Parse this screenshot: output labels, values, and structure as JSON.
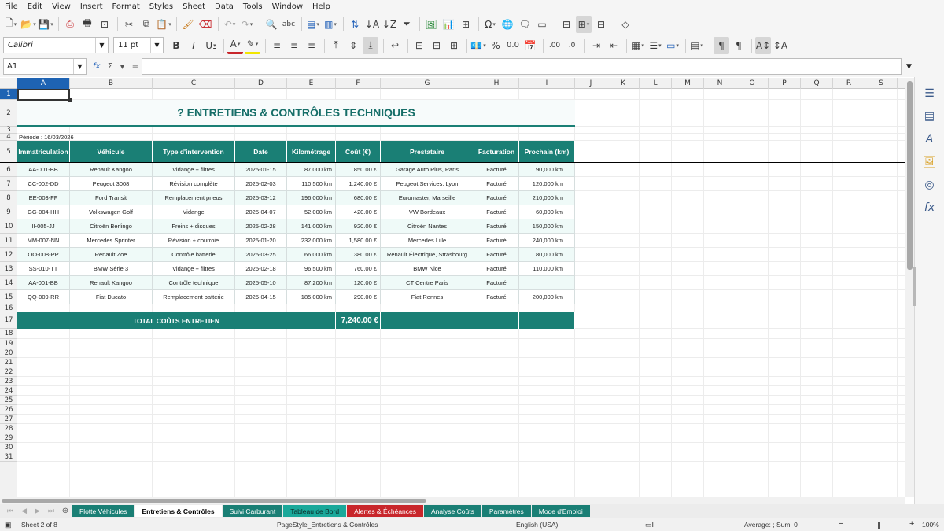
{
  "menu": [
    "File",
    "Edit",
    "View",
    "Insert",
    "Format",
    "Styles",
    "Sheet",
    "Data",
    "Tools",
    "Window",
    "Help"
  ],
  "toolbar": {
    "font_name": "Calibri",
    "font_size": "11 pt"
  },
  "formula_bar": {
    "cell_ref": "A1",
    "fx": "fx",
    "sigma": "Σ",
    "equals": "=",
    "content": ""
  },
  "columns": [
    "A",
    "B",
    "C",
    "D",
    "E",
    "F",
    "G",
    "H",
    "I",
    "J",
    "K",
    "L",
    "M",
    "N",
    "O",
    "P",
    "Q",
    "R",
    "S"
  ],
  "rows": [
    "1",
    "2",
    "3",
    "4",
    "5",
    "6",
    "7",
    "8",
    "9",
    "10",
    "11",
    "12",
    "13",
    "14",
    "15",
    "16",
    "17",
    "18",
    "19",
    "20",
    "21",
    "22",
    "23",
    "24",
    "25",
    "26",
    "27",
    "28",
    "29",
    "30",
    "31"
  ],
  "sheet": {
    "title": "? ENTRETIENS & CONTRÔLES TECHNIQUES",
    "periode": "Période : 16/03/2026",
    "headers": [
      "Immatriculation",
      "Véhicule",
      "Type d'intervention",
      "Date",
      "Kilométrage",
      "Coût (€)",
      "Prestataire",
      "Facturation",
      "Prochain (km)"
    ],
    "data_rows": [
      [
        "AA-001-BB",
        "Renault Kangoo",
        "Vidange + filtres",
        "2025-01-15",
        "87,000  km",
        "850.00 €",
        "Garage Auto Plus, Paris",
        "Facturé",
        "90,000  km"
      ],
      [
        "CC-002-DD",
        "Peugeot 3008",
        "Révision complète",
        "2025-02-03",
        "110,500  km",
        "1,240.00 €",
        "Peugeot Services, Lyon",
        "Facturé",
        "120,000  km"
      ],
      [
        "EE-003-FF",
        "Ford Transit",
        "Remplacement pneus",
        "2025-03-12",
        "196,000  km",
        "680.00 €",
        "Euromaster, Marseille",
        "Facturé",
        "210,000  km"
      ],
      [
        "GG-004-HH",
        "Volkswagen Golf",
        "Vidange",
        "2025-04-07",
        "52,000  km",
        "420.00 €",
        "VW Bordeaux",
        "Facturé",
        "60,000  km"
      ],
      [
        "II-005-JJ",
        "Citroën Berlingo",
        "Freins + disques",
        "2025-02-28",
        "141,000  km",
        "920.00 €",
        "Citroën Nantes",
        "Facturé",
        "150,000  km"
      ],
      [
        "MM-007-NN",
        "Mercedes Sprinter",
        "Révision + courroie",
        "2025-01-20",
        "232,000  km",
        "1,580.00 €",
        "Mercedes Lille",
        "Facturé",
        "240,000  km"
      ],
      [
        "OO-008-PP",
        "Renault Zoe",
        "Contrôle batterie",
        "2025-03-25",
        "66,000  km",
        "380.00 €",
        "Renault Électrique, Strasbourg",
        "Facturé",
        "80,000  km"
      ],
      [
        "SS-010-TT",
        "BMW Série 3",
        "Vidange + filtres",
        "2025-02-18",
        "96,500  km",
        "760.00 €",
        "BMW Nice",
        "Facturé",
        "110,000  km"
      ],
      [
        "AA-001-BB",
        "Renault Kangoo",
        "Contrôle technique",
        "2025-05-10",
        "87,200  km",
        "120.00 €",
        "CT Centre Paris",
        "Facturé",
        ""
      ],
      [
        "QQ-009-RR",
        "Fiat Ducato",
        "Remplacement batterie",
        "2025-04-15",
        "185,000  km",
        "290.00 €",
        "Fiat Rennes",
        "Facturé",
        "200,000  km"
      ]
    ],
    "total_label": "TOTAL COÛTS ENTRETIEN",
    "total_value": "7,240.00 €"
  },
  "tabs": [
    {
      "label": "Flotte Véhicules",
      "style": "teal"
    },
    {
      "label": "Entretiens & Contrôles",
      "style": "active"
    },
    {
      "label": "Suivi Carburant",
      "style": "teal"
    },
    {
      "label": "Tableau de Bord",
      "style": "blue"
    },
    {
      "label": "Alertes & Échéances",
      "style": "red"
    },
    {
      "label": "Analyse Coûts",
      "style": "teal"
    },
    {
      "label": "Paramètres",
      "style": "teal"
    },
    {
      "label": "Mode d'Emploi",
      "style": "teal"
    }
  ],
  "status": {
    "sheet_pos": "Sheet 2 of 8",
    "page_style": "PageStyle_Entretiens & Contrôles",
    "language": "English (USA)",
    "summary": "Average: ; Sum: 0",
    "zoom_minus": "−",
    "zoom_plus": "+",
    "zoom": "100%"
  },
  "colors": {
    "accent": "#1a7f75",
    "row_alt": "#effaf8",
    "selection": "#1e63b3",
    "alert_tab": "#c8262b"
  }
}
